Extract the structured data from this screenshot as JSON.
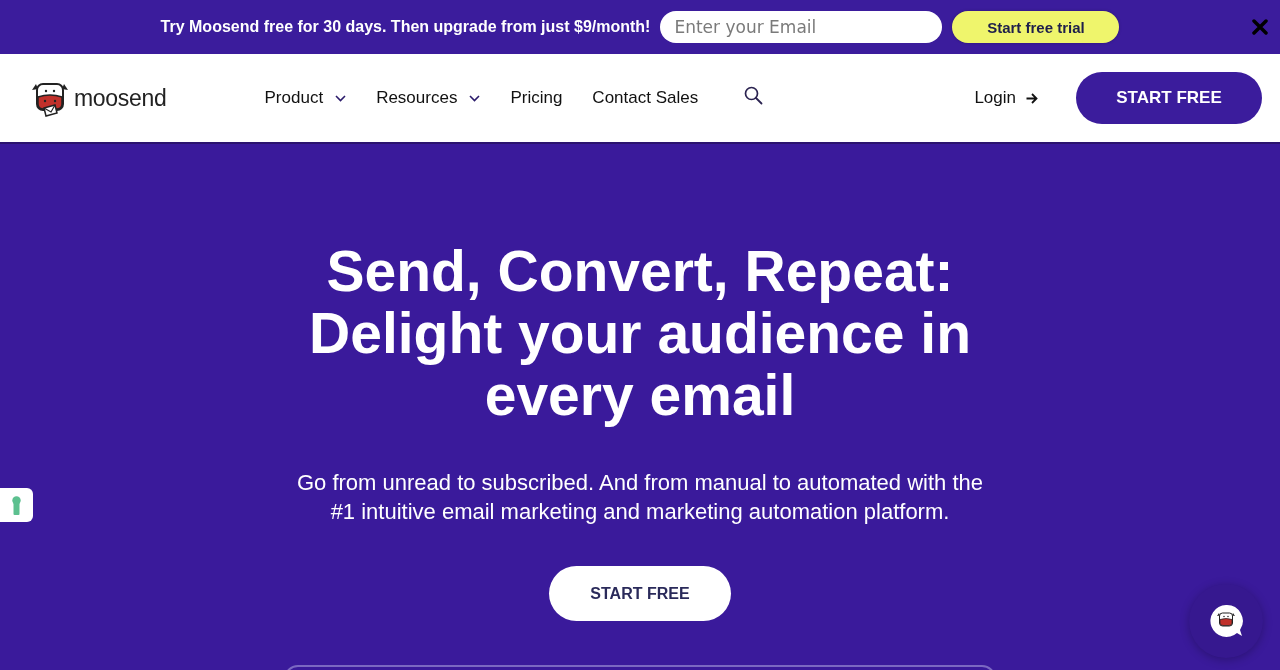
{
  "promo_bar": {
    "message": "Try Moosend free for 30 days. Then upgrade from just $9/month!",
    "email_field": {
      "placeholder": "Enter your Email"
    },
    "trial_button": "Start free trial"
  },
  "header": {
    "logo_text": "moosend",
    "nav": [
      {
        "label": "Product",
        "kind": "dropdown"
      },
      {
        "label": "Resources",
        "kind": "dropdown"
      },
      {
        "label": "Pricing",
        "kind": "link"
      },
      {
        "label": "Contact Sales",
        "kind": "link"
      }
    ],
    "login": "Login",
    "cta": "START FREE"
  },
  "hero": {
    "headline": "Send, Convert, Repeat: Delight your audience in every email",
    "subtitle": "Go from unread to subscribed. And from manual to automated with the #1 intuitive email marketing and marketing automation platform.",
    "cta": "START FREE"
  }
}
